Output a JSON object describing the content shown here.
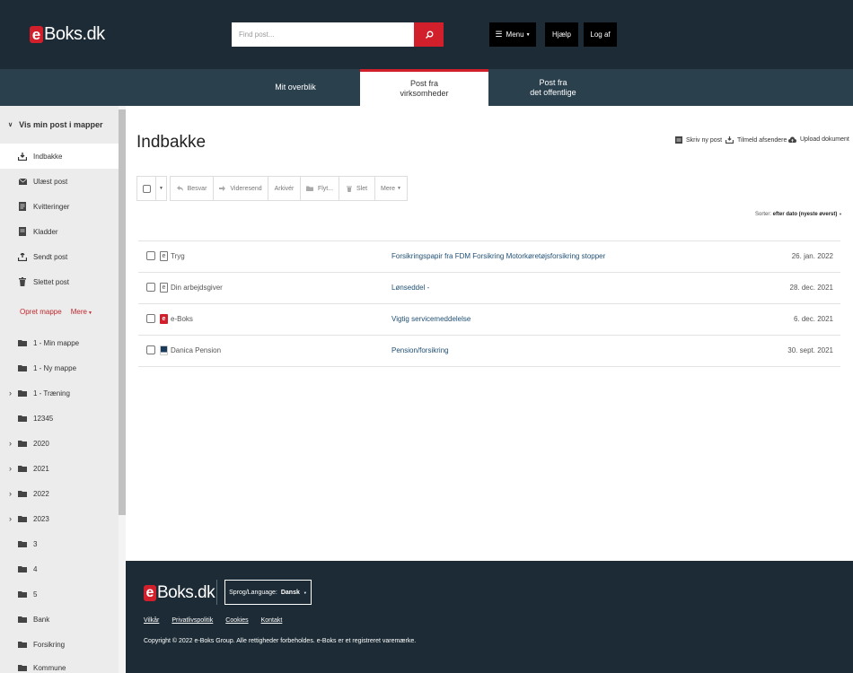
{
  "header": {
    "logo_e": "e",
    "logo_text": "Boks.dk",
    "search_placeholder": "Find post...",
    "menu_label": "Menu",
    "help_label": "Hjælp",
    "logout_label": "Log af"
  },
  "nav": {
    "tabs": [
      {
        "label": "Mit overblik"
      },
      {
        "label_line1": "Post fra",
        "label_line2": "virksomheder"
      },
      {
        "label_line1": "Post fra",
        "label_line2": "det offentlige"
      }
    ]
  },
  "sidebar": {
    "heading": "Vis min post i mapper",
    "system_items": [
      {
        "label": "Indbakke",
        "icon": "inbox-icon"
      },
      {
        "label": "Ulæst post",
        "icon": "envelope-icon"
      },
      {
        "label": "Kvitteringer",
        "icon": "receipt-icon"
      },
      {
        "label": "Kladder",
        "icon": "draft-icon"
      },
      {
        "label": "Sendt post",
        "icon": "sent-icon"
      },
      {
        "label": "Slettet post",
        "icon": "trash-icon"
      }
    ],
    "create_folder": "Opret mappe",
    "more": "Mere",
    "folders": [
      {
        "label": "1 - Min mappe"
      },
      {
        "label": "1 - Ny mappe"
      },
      {
        "label": "1 - Træning"
      },
      {
        "label": "12345"
      },
      {
        "label": "2020"
      },
      {
        "label": "2021"
      },
      {
        "label": "2022"
      },
      {
        "label": "2023"
      },
      {
        "label": "3"
      },
      {
        "label": "4"
      },
      {
        "label": "5"
      },
      {
        "label": "Bank"
      },
      {
        "label": "Forsikring"
      },
      {
        "label": "Kommune"
      }
    ]
  },
  "main": {
    "title": "Indbakke",
    "actions": {
      "write": "Skriv ny post",
      "subscribe": "Tilmeld afsendere",
      "upload": "Upload dokument"
    },
    "toolbar": {
      "reply": "Besvar",
      "forward": "Videresend",
      "archive": "Arkivér",
      "move": "Flyt...",
      "delete": "Slet",
      "more": "Mere"
    },
    "sort_label": "Sorter:",
    "sort_value": "efter dato (nyeste øverst)",
    "messages": [
      {
        "sender": "Tryg",
        "subject": "Forsikringspapir fra FDM Forsikring Motorkøretøjsforsikring stopper",
        "date": "26. jan. 2022"
      },
      {
        "sender": "Din arbejdsgiver",
        "subject": "Lønseddel -",
        "date": "28. dec. 2021"
      },
      {
        "sender": "e-Boks",
        "subject": "Vigtig servicemeddelelse",
        "date": "6. dec. 2021"
      },
      {
        "sender": "Danica Pension",
        "subject": "Pension/forsikring",
        "date": "30. sept. 2021"
      }
    ]
  },
  "footer": {
    "lang_label": "Sprog/Language:",
    "lang_value": "Dansk",
    "links": [
      "Vilkår",
      "Privatlivspolitik",
      "Cookies",
      "Kontakt"
    ],
    "copyright": "Copyright © 2022 e-Boks Group. Alle rettigheder forbeholdes. e-Boks er et registreret varemærke."
  }
}
